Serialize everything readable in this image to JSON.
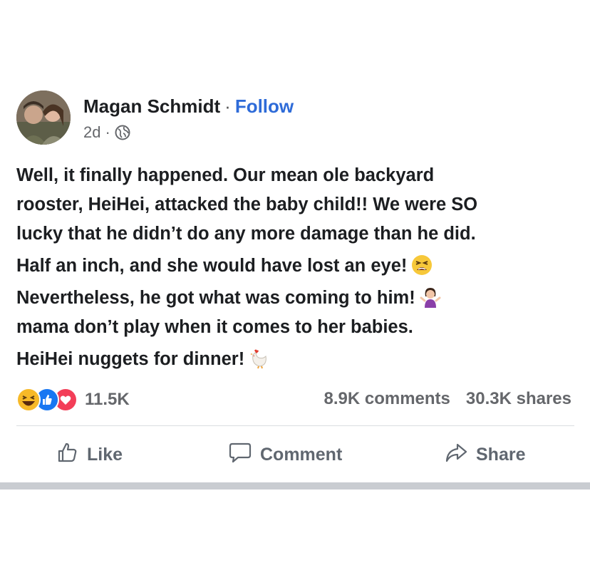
{
  "post": {
    "author": "Magan Schmidt",
    "separator": "·",
    "follow_label": "Follow",
    "time": "2d",
    "time_separator": "·",
    "privacy_icon": "globe-icon",
    "lines": [
      "Well, it finally happened. Our mean ole backyard",
      "rooster, HeiHei, attacked the baby child!! We were SO",
      "lucky that he didn’t do any more damage than he did.",
      "Half an inch, and she would have lost an eye!",
      "Nevertheless, he got what was coming to him!",
      "mama don’t play when it comes to her babies.",
      "HeiHei nuggets for dinner!"
    ],
    "emojis": [
      "tired-face-emoji",
      "woman-shrugging-emoji",
      "rooster-emoji"
    ]
  },
  "stats": {
    "reaction_icons": [
      "haha-reaction-icon",
      "like-reaction-icon",
      "love-reaction-icon"
    ],
    "reactions_count": "11.5K",
    "comments": "8.9K comments",
    "shares": "30.3K shares"
  },
  "actions": {
    "like_label": "Like",
    "comment_label": "Comment",
    "share_label": "Share"
  },
  "colors": {
    "follow": "#2e6bd8",
    "like_blue": "#1877f2",
    "love_red": "#f33e58",
    "haha_yellow": "#f7b928",
    "muted_text": "#65676b"
  }
}
